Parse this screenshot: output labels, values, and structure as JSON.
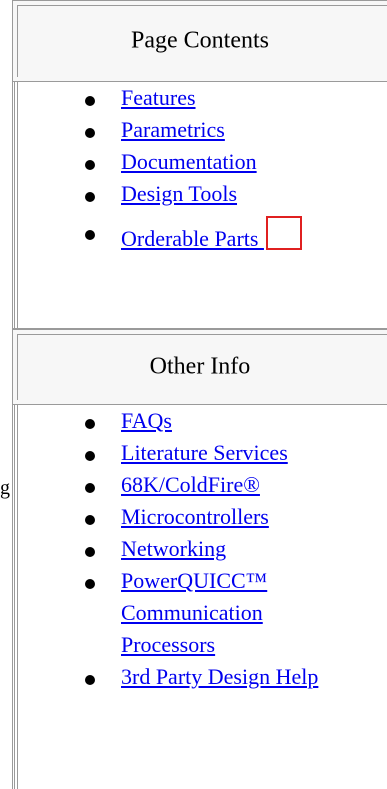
{
  "stray_text": "g",
  "sections": [
    {
      "title": "Page Contents",
      "links": [
        {
          "label": "Features"
        },
        {
          "label": "Parametrics"
        },
        {
          "label": "Documentation"
        },
        {
          "label": "Design Tools"
        },
        {
          "label": "Orderable Parts "
        }
      ]
    },
    {
      "title": "Other Info",
      "links": [
        {
          "label": "FAQs"
        },
        {
          "label": "Literature Services"
        },
        {
          "label": "68K/ColdFire®"
        },
        {
          "label": "Microcontrollers"
        },
        {
          "label": "Networking"
        },
        {
          "label": "PowerQUICC™ Communication Processors"
        },
        {
          "label": "3rd Party Design Help"
        }
      ]
    }
  ],
  "colors": {
    "link": "#0000ee",
    "border": "#9a9a9a",
    "header_bg": "#f7f7f7",
    "highlight_box": "#e02020"
  },
  "icons": {
    "bullet": "filled-circle-bullet-icon",
    "highlight": "red-outline-box-icon"
  }
}
